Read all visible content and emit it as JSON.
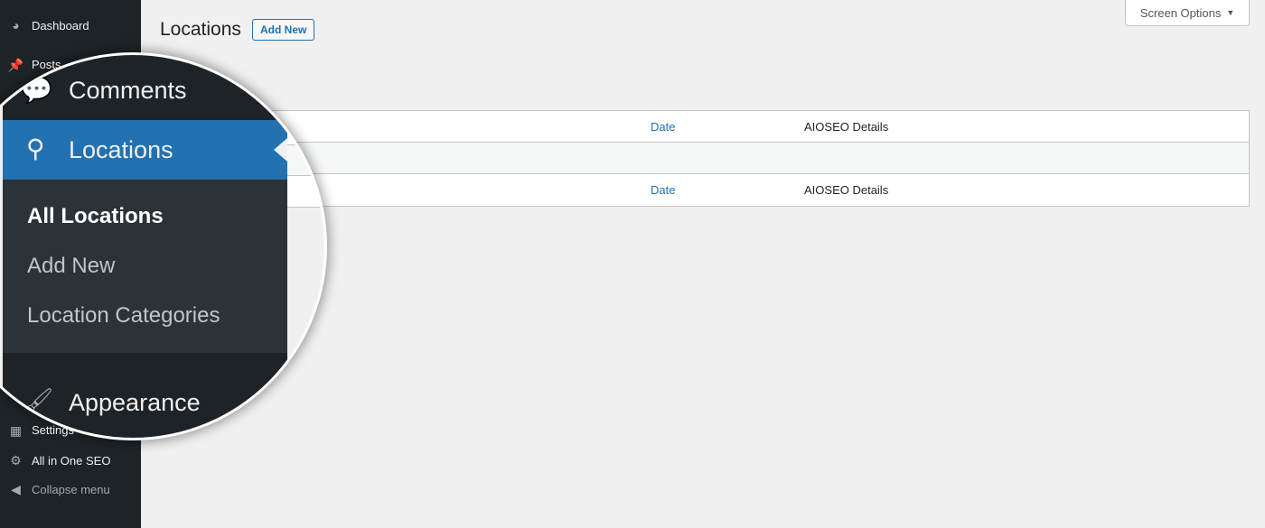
{
  "sidebar": {
    "items": [
      {
        "label": "Dashboard",
        "icon": "dashboard-icon"
      },
      {
        "label": "Posts",
        "icon": "pin-icon"
      },
      {
        "label": "Settings",
        "icon": "settings-icon"
      },
      {
        "label": "All in One SEO",
        "icon": "aioseo-icon"
      },
      {
        "label": "Collapse menu",
        "icon": "collapse-icon"
      }
    ]
  },
  "magnified": {
    "comments": "Comments",
    "locations": "Locations",
    "submenu": [
      "All Locations",
      "Add New",
      "Location Categories"
    ],
    "appearance": "Appearance"
  },
  "header": {
    "title": "Locations",
    "add_new": "Add New",
    "screen_options": "Screen Options"
  },
  "table": {
    "columns": {
      "date": "Date",
      "seo": "AIOSEO Details"
    }
  },
  "colors": {
    "accent": "#2271b1",
    "sidebar": "#1d2327",
    "submenu": "#2c3338"
  }
}
